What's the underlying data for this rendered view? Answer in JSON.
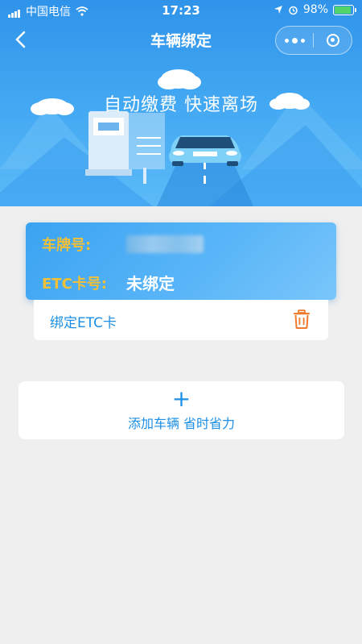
{
  "status_bar": {
    "carrier": "中国电信",
    "time": "17:23",
    "battery": "98%",
    "icons": [
      "signal-icon",
      "wifi-icon",
      "location-icon",
      "alarm-icon",
      "battery-icon"
    ]
  },
  "nav": {
    "title": "车辆绑定",
    "icons": [
      "back-icon",
      "more-icon",
      "close-icon"
    ]
  },
  "banner": {
    "slogan": "自动缴费 快速离场"
  },
  "vehicle_card": {
    "plate_label": "车牌号:",
    "etc_label": "ETC卡号:",
    "etc_value": "未绑定",
    "bind_action": "绑定ETC卡",
    "delete_icon": "trash-icon"
  },
  "add_vehicle": {
    "plus": "+",
    "label": "添加车辆 省时省力"
  },
  "colors": {
    "primary": "#1d8fe6",
    "label_gold": "#f2c036",
    "delete_orange": "#f07a2c",
    "page_bg": "#efefef"
  }
}
